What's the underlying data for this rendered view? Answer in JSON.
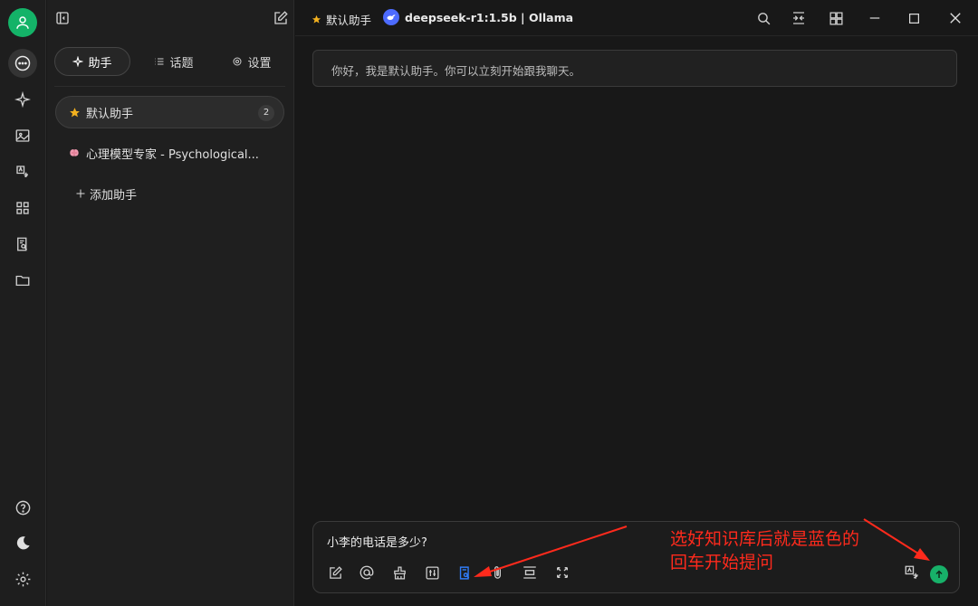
{
  "sidebar_tabs": [
    {
      "label": "助手"
    },
    {
      "label": "话题"
    },
    {
      "label": "设置"
    }
  ],
  "assistants": [
    {
      "label": "默认助手",
      "count": "2"
    },
    {
      "label": "心理模型专家 - Psychological..."
    }
  ],
  "add_assistant_label": "添加助手",
  "header": {
    "assistant_title": "默认助手",
    "model_label": "deepseek-r1:1.5b | Ollama"
  },
  "chat": {
    "greeting": "你好，我是默认助手。你可以立刻开始跟我聊天。"
  },
  "composer": {
    "input_value": "小李的电话是多少?"
  },
  "annotation": {
    "line1": "选好知识库后就是蓝色的",
    "line2": "回车开始提问"
  },
  "colors": {
    "accent_green": "#17b169",
    "knowledge_blue": "#2f7bf6",
    "annotation_red": "#ff2a1c",
    "star": "#f3b11f"
  },
  "icons": {
    "rail": [
      "chat-icon",
      "sparkle-icon",
      "image-icon",
      "translate-icon",
      "apps-icon",
      "knowledge-icon",
      "folder-icon",
      "help-icon",
      "moon-icon",
      "gear-icon"
    ],
    "composer": [
      "new-topic-icon",
      "mention-icon",
      "clear-icon",
      "settings-sliders-icon",
      "knowledge-base-icon",
      "attachment-icon",
      "collapse-icon",
      "expand-icon",
      "translate-icon",
      "send-icon"
    ]
  }
}
